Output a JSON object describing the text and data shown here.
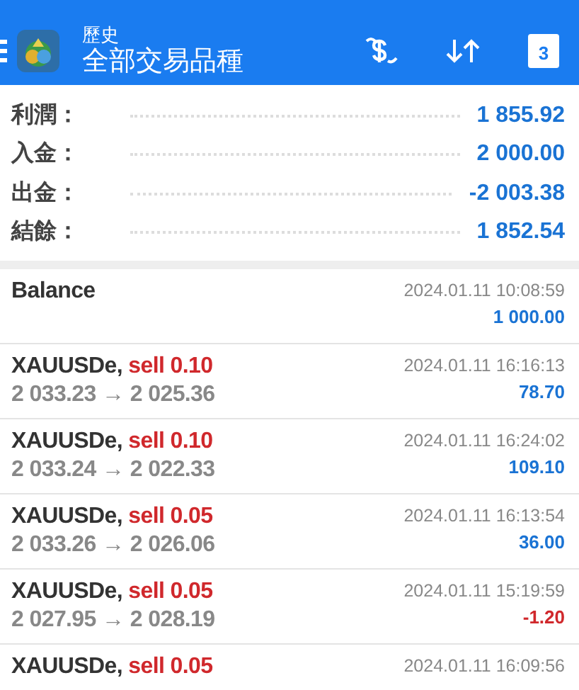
{
  "header": {
    "subtitle": "歷史",
    "title": "全部交易品種",
    "calendar_day": "3"
  },
  "summary": [
    {
      "label": "利潤：",
      "value": "1 855.92"
    },
    {
      "label": "入金：",
      "value": "2 000.00"
    },
    {
      "label": "出金：",
      "value": "-2 003.38"
    },
    {
      "label": "結餘：",
      "value": "1 852.54"
    }
  ],
  "deals": [
    {
      "kind": "balance",
      "title": "Balance",
      "time": "2024.01.11 10:08:59",
      "profit": "1 000.00",
      "loss": false
    },
    {
      "kind": "trade",
      "symbol": "XAUUSDe,",
      "side": "sell 0.10",
      "prices": "2 033.23 → 2 025.36",
      "time": "2024.01.11 16:16:13",
      "profit": "78.70",
      "loss": false
    },
    {
      "kind": "trade",
      "symbol": "XAUUSDe,",
      "side": "sell 0.10",
      "prices": "2 033.24 → 2 022.33",
      "time": "2024.01.11 16:24:02",
      "profit": "109.10",
      "loss": false
    },
    {
      "kind": "trade",
      "symbol": "XAUUSDe,",
      "side": "sell 0.05",
      "prices": "2 033.26 → 2 026.06",
      "time": "2024.01.11 16:13:54",
      "profit": "36.00",
      "loss": false
    },
    {
      "kind": "trade",
      "symbol": "XAUUSDe,",
      "side": "sell 0.05",
      "prices": "2 027.95 → 2 028.19",
      "time": "2024.01.11 15:19:59",
      "profit": "-1.20",
      "loss": true
    },
    {
      "kind": "trade",
      "symbol": "XAUUSDe,",
      "side": "sell 0.05",
      "time": "2024.01.11 16:09:56"
    }
  ]
}
